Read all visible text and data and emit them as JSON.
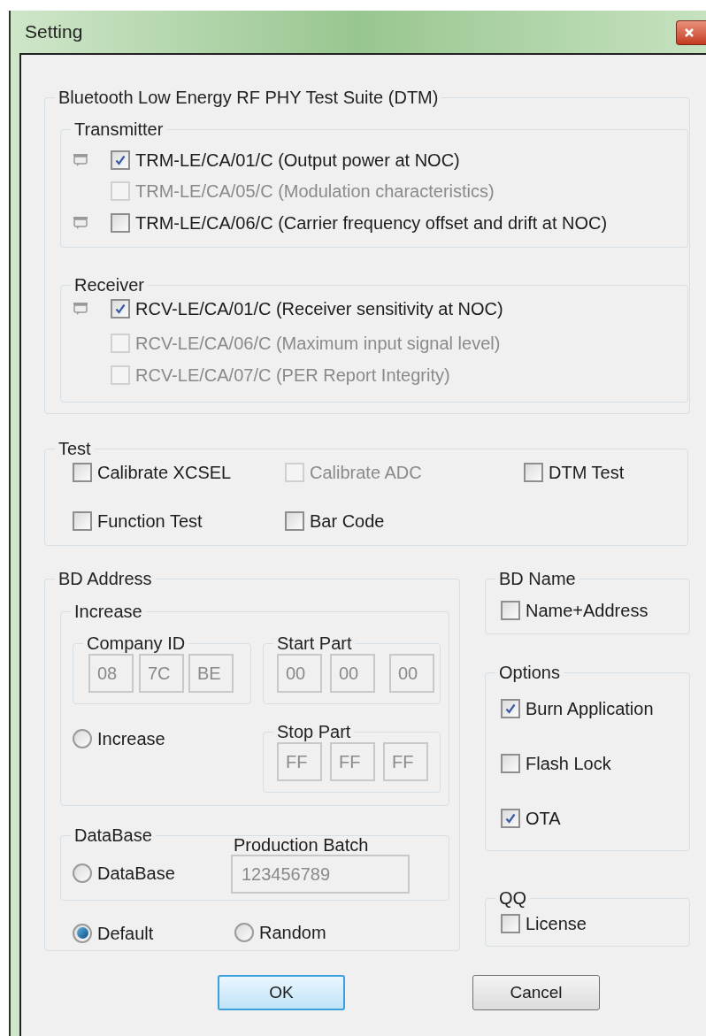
{
  "window": {
    "title": "Setting"
  },
  "dtm_group": {
    "title": "Bluetooth Low Energy RF PHY Test Suite (DTM)",
    "transmitter": {
      "title": "Transmitter",
      "items": [
        {
          "label": "TRM-LE/CA/01/C (Output power at NOC)",
          "flag_icon": true,
          "checked": true,
          "disabled": false
        },
        {
          "label": "TRM-LE/CA/05/C (Modulation characteristics)",
          "flag_icon": false,
          "checked": false,
          "disabled": true
        },
        {
          "label": "TRM-LE/CA/06/C (Carrier frequency offset and drift at NOC)",
          "flag_icon": true,
          "checked": false,
          "disabled": false
        }
      ]
    },
    "receiver": {
      "title": "Receiver",
      "items": [
        {
          "label": "RCV-LE/CA/01/C (Receiver sensitivity at NOC)",
          "flag_icon": true,
          "checked": true,
          "disabled": false
        },
        {
          "label": "RCV-LE/CA/06/C (Maximum input signal level)",
          "flag_icon": false,
          "checked": false,
          "disabled": true
        },
        {
          "label": "RCV-LE/CA/07/C (PER Report Integrity)",
          "flag_icon": false,
          "checked": false,
          "disabled": true
        }
      ]
    }
  },
  "test": {
    "title": "Test",
    "items": [
      {
        "label": "Calibrate XCSEL",
        "checked": false,
        "disabled": false
      },
      {
        "label": "Calibrate ADC",
        "checked": false,
        "disabled": true
      },
      {
        "label": "DTM Test",
        "checked": false,
        "disabled": false
      },
      {
        "label": "Function Test",
        "checked": false,
        "disabled": false
      },
      {
        "label": "Bar Code",
        "checked": false,
        "disabled": false
      }
    ]
  },
  "bd_address": {
    "title": "BD Address",
    "increase": {
      "title": "Increase",
      "company_id": {
        "title": "Company ID",
        "fields": [
          "08",
          "7C",
          "BE"
        ]
      },
      "start_part": {
        "title": "Start Part",
        "fields": [
          "00",
          "00",
          "00"
        ]
      },
      "radio": {
        "label": "Increase",
        "selected": false
      },
      "stop_part": {
        "title": "Stop Part",
        "fields": [
          "FF",
          "FF",
          "FF"
        ]
      }
    },
    "database": {
      "title": "DataBase",
      "radio": {
        "label": "DataBase",
        "selected": false
      },
      "batch_label": "Production Batch",
      "batch_value": "123456789"
    },
    "mode_radios": [
      {
        "label": "Default",
        "selected": true
      },
      {
        "label": "Random",
        "selected": false
      }
    ]
  },
  "bd_name": {
    "title": "BD Name",
    "items": [
      {
        "label": "Name+Address",
        "checked": false,
        "disabled": false
      }
    ]
  },
  "options": {
    "title": "Options",
    "items": [
      {
        "label": "Burn Application",
        "checked": true,
        "disabled": false
      },
      {
        "label": "Flash Lock",
        "checked": false,
        "disabled": false
      },
      {
        "label": "OTA",
        "checked": true,
        "disabled": false
      }
    ]
  },
  "qq": {
    "title": "QQ",
    "items": [
      {
        "label": "License",
        "checked": false,
        "disabled": false
      }
    ]
  },
  "buttons": [
    {
      "label": "OK",
      "default": true
    },
    {
      "label": "Cancel",
      "default": false
    }
  ]
}
